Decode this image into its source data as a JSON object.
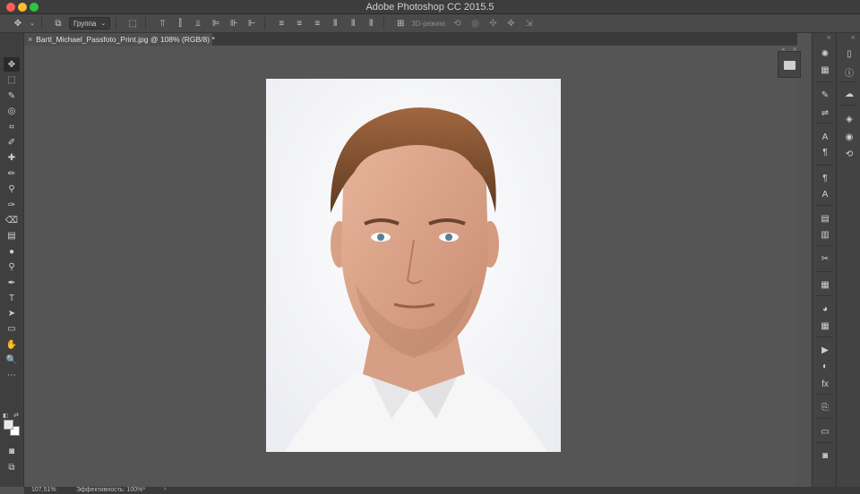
{
  "window": {
    "title": "Adobe Photoshop CC 2015.5"
  },
  "options_bar": {
    "auto_select_value": "Группа",
    "mode_3d_label": "3D-режим:"
  },
  "document": {
    "tab_title": "Bartl_Michael_Passfoto_Print.jpg @ 108% (RGB/8) *",
    "close_glyph": "×"
  },
  "status": {
    "zoom": "107,51%",
    "efficiency": "Эффективность: 100%*",
    "arrow": "›"
  },
  "colors": {
    "foreground": "#eaeaea",
    "background": "#ffffff",
    "accent_close": "#ff5f57",
    "accent_min": "#febc2e",
    "accent_max": "#28c840"
  },
  "toolbar_icons": [
    "move-icon",
    "marquee-icon",
    "lasso-icon",
    "quick-selection-icon",
    "crop-icon",
    "eyedropper-icon",
    "healing-brush-icon",
    "brush-icon",
    "clone-stamp-icon",
    "history-brush-icon",
    "eraser-icon",
    "gradient-icon",
    "blur-icon",
    "dodge-icon",
    "pen-icon",
    "type-icon",
    "path-selection-icon",
    "rectangle-icon",
    "hand-icon",
    "zoom-icon",
    "more-tools-icon"
  ],
  "toolbar_glyphs": [
    "✥",
    "⬚",
    "✎",
    "◎",
    "⌗",
    "✐",
    "✚",
    "✏",
    "⚲",
    "✑",
    "⌫",
    "▤",
    "●",
    "⚲",
    "✒",
    "T",
    "➤",
    "▭",
    "✋",
    "🔍",
    "⋯"
  ],
  "panel1_icons": [
    "navigator-icon",
    "histogram-icon",
    "brush-settings-icon",
    "adjustments-icon",
    "character-icon",
    "paragraph-icon",
    "paragraph-styles-icon",
    "character-styles-icon",
    "notes-icon",
    "properties-icon",
    "tools-presets-icon",
    "layer-comps-icon",
    "color-icon",
    "swatches-icon",
    "actions-icon",
    "styles-icon",
    "fx-icon",
    "clone-source-icon",
    "timeline-icon",
    "libraries-icon"
  ],
  "panel1_glyphs": [
    "✺",
    "▦",
    "✎",
    "⇌",
    "A",
    "¶",
    "¶",
    "A",
    "▤",
    "▥",
    "✂",
    "▦",
    "◕",
    "▦",
    "▶",
    "◐",
    "fx",
    "⎘",
    "▭",
    "◙"
  ],
  "panel2_icons": [
    "device-icon",
    "info-icon",
    "cloud-icon",
    "layers-icon",
    "channels-icon",
    "paths-icon"
  ],
  "panel2_glyphs": [
    "▯",
    "ⓘ",
    "☁",
    "◈",
    "◉",
    "⟲"
  ],
  "float_panel": {
    "icon": "panel-icon",
    "close_glyph": "×",
    "collapse_glyph": "«"
  }
}
